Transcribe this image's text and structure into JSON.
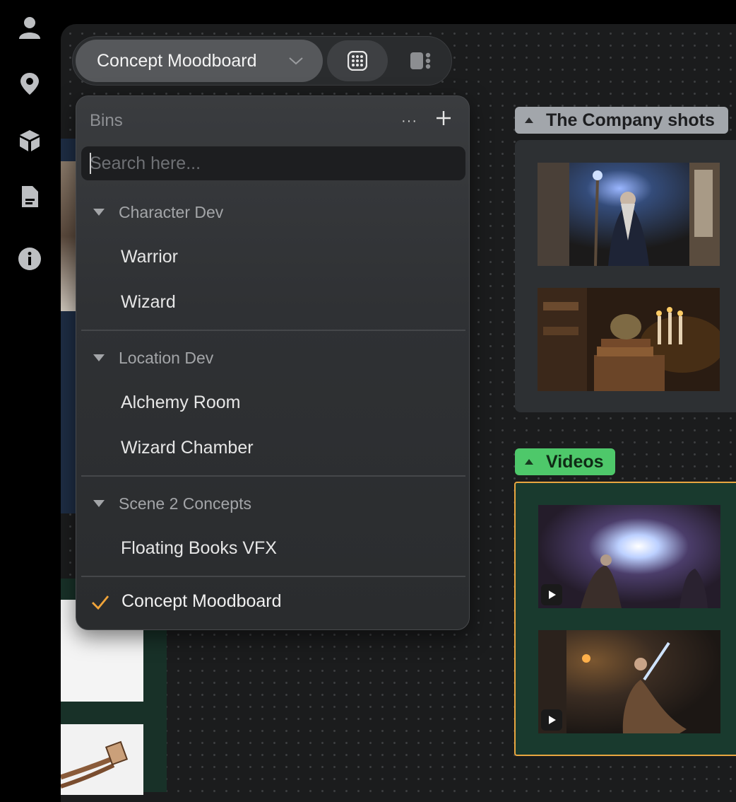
{
  "rail": {
    "icons": [
      "user-icon",
      "location-pin-icon",
      "cube-icon",
      "document-icon",
      "info-icon"
    ]
  },
  "toolbar": {
    "project_label": "Concept Moodboard",
    "views": [
      "grid-view-icon",
      "panel-view-icon"
    ]
  },
  "bins": {
    "title": "Bins",
    "more_label": "···",
    "search_placeholder": "Search here...",
    "groups": [
      {
        "label": "Character Dev",
        "items": [
          "Warrior",
          "Wizard"
        ]
      },
      {
        "label": "Location Dev",
        "items": [
          "Alchemy Room",
          "Wizard Chamber"
        ]
      },
      {
        "label": "Scene 2 Concepts",
        "items": [
          "Floating Books VFX"
        ]
      }
    ],
    "selected": "Concept Moodboard"
  },
  "canvas": {
    "groups": [
      {
        "title": "The Company shots",
        "color": "#a2a6ab",
        "thumbnails": [
          "wizard-with-staff",
          "toad-on-books-candles"
        ]
      },
      {
        "title": "Videos",
        "color": "#4ec86a",
        "thumbnails": [
          "spell-explosion-video",
          "warrior-with-sword-video"
        ]
      }
    ]
  },
  "colors": {
    "accent_check": "#f0a43a",
    "videos_border": "#e9a640"
  }
}
